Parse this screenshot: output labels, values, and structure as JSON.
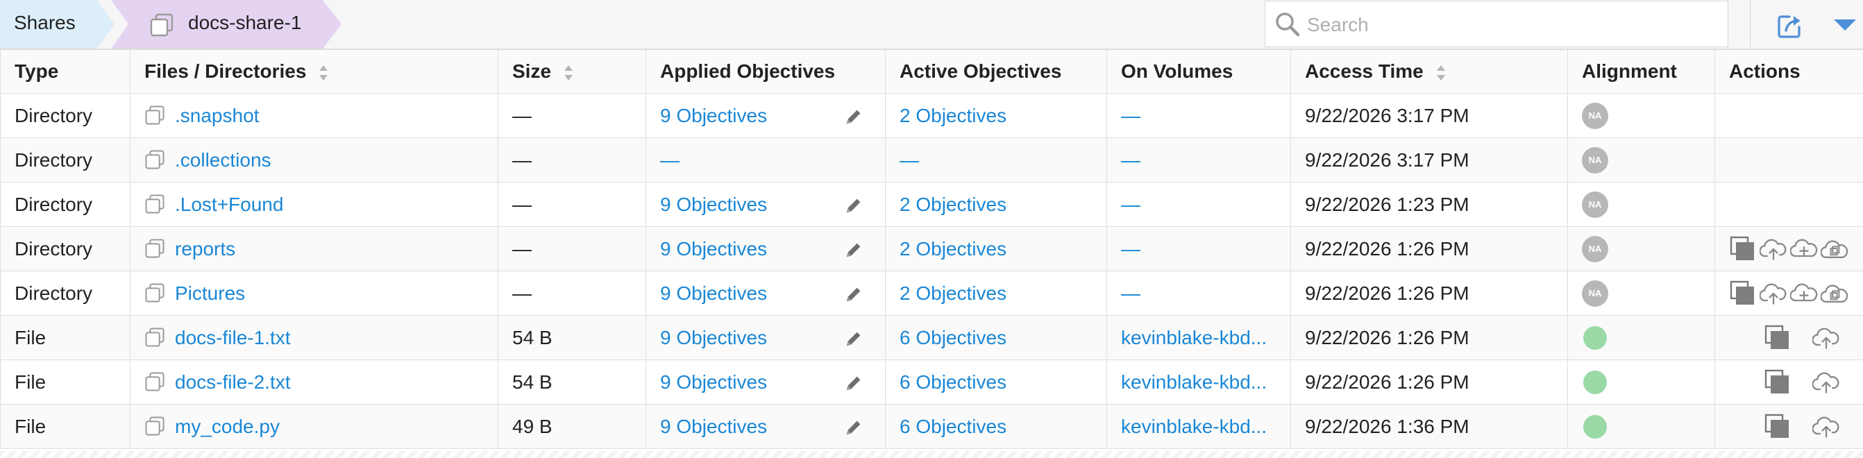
{
  "breadcrumb": {
    "root": "Shares",
    "current": "docs-share-1"
  },
  "search": {
    "placeholder": "Search",
    "value": ""
  },
  "icons": {
    "search": "search-icon",
    "export": "external-link-icon",
    "menu": "caret-down-icon",
    "copy": "copy-icon",
    "edit": "pencil-icon",
    "upload": "cloud-upload-icon",
    "add": "cloud-add-icon"
  },
  "colors": {
    "link": "#1a87d6",
    "na_badge": "#b7b7b7",
    "ok": "#9ad9a6",
    "breadcrumb_root": "#dceefa",
    "breadcrumb_current": "#e4d4f1"
  },
  "table": {
    "headers": {
      "type": "Type",
      "name": "Files / Directories",
      "size": "Size",
      "applied": "Applied Objectives",
      "active": "Active Objectives",
      "volumes": "On Volumes",
      "access": "Access Time",
      "alignment": "Alignment",
      "actions": "Actions"
    },
    "rows": [
      {
        "type": "Directory",
        "name": ".snapshot",
        "size": "—",
        "applied": "9 Objectives",
        "active": "2 Objectives",
        "volumes": "—",
        "access": "9/22/2026 3:17 PM",
        "alignment": "NA"
      },
      {
        "type": "Directory",
        "name": ".collections",
        "size": "—",
        "applied": "—",
        "active": "—",
        "volumes": "—",
        "access": "9/22/2026 3:17 PM",
        "alignment": "NA"
      },
      {
        "type": "Directory",
        "name": ".Lost+Found",
        "size": "—",
        "applied": "9 Objectives",
        "active": "2 Objectives",
        "volumes": "—",
        "access": "9/22/2026 1:23 PM",
        "alignment": "NA"
      },
      {
        "type": "Directory",
        "name": "reports",
        "size": "—",
        "applied": "9 Objectives",
        "active": "2 Objectives",
        "volumes": "—",
        "access": "9/22/2026 1:26 PM",
        "alignment": "NA"
      },
      {
        "type": "Directory",
        "name": "Pictures",
        "size": "—",
        "applied": "9 Objectives",
        "active": "2 Objectives",
        "volumes": "—",
        "access": "9/22/2026 1:26 PM",
        "alignment": "NA"
      },
      {
        "type": "File",
        "name": "docs-file-1.txt",
        "size": "54 B",
        "applied": "9 Objectives",
        "active": "6 Objectives",
        "volumes": "kevinblake-kbd...",
        "access": "9/22/2026 1:26 PM",
        "alignment": ""
      },
      {
        "type": "File",
        "name": "docs-file-2.txt",
        "size": "54 B",
        "applied": "9 Objectives",
        "active": "6 Objectives",
        "volumes": "kevinblake-kbd...",
        "access": "9/22/2026 1:26 PM",
        "alignment": ""
      },
      {
        "type": "File",
        "name": "my_code.py",
        "size": "49 B",
        "applied": "9 Objectives",
        "active": "6 Objectives",
        "volumes": "kevinblake-kbd...",
        "access": "9/22/2026 1:36 PM",
        "alignment": ""
      }
    ]
  }
}
